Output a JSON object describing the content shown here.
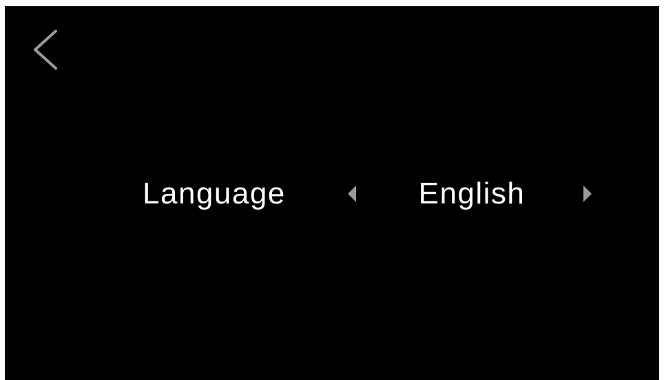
{
  "header": {
    "back_icon": "chevron-left-icon"
  },
  "setting": {
    "label": "Language",
    "value": "English",
    "prev_icon": "triangle-left-icon",
    "next_icon": "triangle-right-icon"
  },
  "colors": {
    "background": "#000000",
    "text": "#ffffff",
    "icon": "#9a9a9a"
  }
}
